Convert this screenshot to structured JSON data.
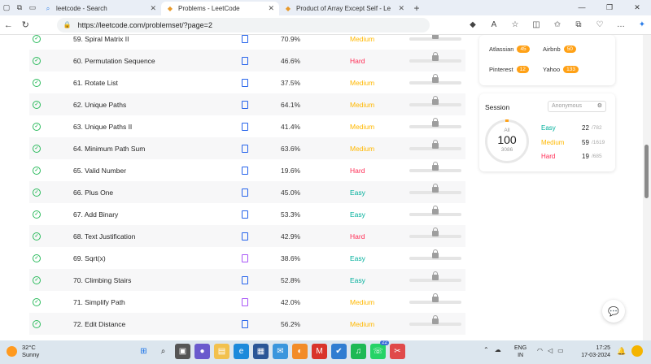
{
  "browser": {
    "tabs": [
      {
        "label": "leetcode - Search",
        "icon": "search-icon",
        "active": false
      },
      {
        "label": "Problems - LeetCode",
        "icon": "leetcode-icon",
        "active": true
      },
      {
        "label": "Product of Array Except Self - Le",
        "icon": "leetcode-icon",
        "active": false
      }
    ],
    "url": "https://leetcode.com/problemset/?page=2"
  },
  "problems": [
    {
      "title": "59. Spiral Matrix II",
      "acceptance": "70.9%",
      "difficulty": "Medium",
      "solution_type": "article"
    },
    {
      "title": "60. Permutation Sequence",
      "acceptance": "46.6%",
      "difficulty": "Hard",
      "solution_type": "article"
    },
    {
      "title": "61. Rotate List",
      "acceptance": "37.5%",
      "difficulty": "Medium",
      "solution_type": "article"
    },
    {
      "title": "62. Unique Paths",
      "acceptance": "64.1%",
      "difficulty": "Medium",
      "solution_type": "article"
    },
    {
      "title": "63. Unique Paths II",
      "acceptance": "41.4%",
      "difficulty": "Medium",
      "solution_type": "article"
    },
    {
      "title": "64. Minimum Path Sum",
      "acceptance": "63.6%",
      "difficulty": "Medium",
      "solution_type": "article"
    },
    {
      "title": "65. Valid Number",
      "acceptance": "19.6%",
      "difficulty": "Hard",
      "solution_type": "article"
    },
    {
      "title": "66. Plus One",
      "acceptance": "45.0%",
      "difficulty": "Easy",
      "solution_type": "article"
    },
    {
      "title": "67. Add Binary",
      "acceptance": "53.3%",
      "difficulty": "Easy",
      "solution_type": "article"
    },
    {
      "title": "68. Text Justification",
      "acceptance": "42.9%",
      "difficulty": "Hard",
      "solution_type": "article"
    },
    {
      "title": "69. Sqrt(x)",
      "acceptance": "38.6%",
      "difficulty": "Easy",
      "solution_type": "video"
    },
    {
      "title": "70. Climbing Stairs",
      "acceptance": "52.8%",
      "difficulty": "Easy",
      "solution_type": "article"
    },
    {
      "title": "71. Simplify Path",
      "acceptance": "42.0%",
      "difficulty": "Medium",
      "solution_type": "video"
    },
    {
      "title": "72. Edit Distance",
      "acceptance": "56.2%",
      "difficulty": "Medium",
      "solution_type": "article"
    }
  ],
  "companies": [
    {
      "name": "Atlassian",
      "count": "45"
    },
    {
      "name": "Airbnb",
      "count": "50"
    },
    {
      "name": "Pinterest",
      "count": "12"
    },
    {
      "name": "Yahoo",
      "count": "133"
    }
  ],
  "session": {
    "title": "Session",
    "selector": "Anonymous",
    "all_label": "All",
    "solved": "100",
    "total": "3086",
    "stats": [
      {
        "name": "Easy",
        "solved": "22",
        "total": "/782",
        "color": "#00af9b"
      },
      {
        "name": "Medium",
        "solved": "59",
        "total": "/1619",
        "color": "#ffb800"
      },
      {
        "name": "Hard",
        "solved": "19",
        "total": "/685",
        "color": "#ff2d55"
      }
    ]
  },
  "taskbar": {
    "temperature": "32°C",
    "weather": "Sunny",
    "lang1": "ENG",
    "lang2": "IN",
    "time": "17:25",
    "date": "17-03-2024",
    "badge": "22"
  },
  "colors": {
    "easy": "#00af9b",
    "medium": "#ffb800",
    "hard": "#ff2d55",
    "accepted": "#2cbb5d"
  }
}
